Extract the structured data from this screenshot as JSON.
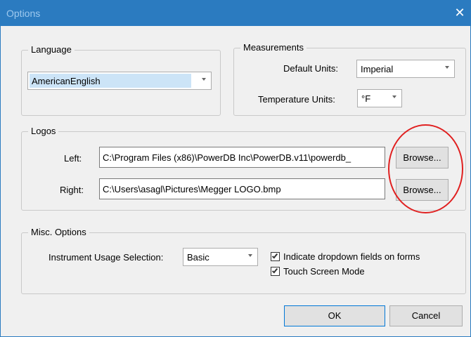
{
  "window": {
    "title": "Options",
    "close_glyph": "✕"
  },
  "language": {
    "group_label": "Language",
    "selected": "AmericanEnglish"
  },
  "measurements": {
    "group_label": "Measurements",
    "default_units_label": "Default Units:",
    "default_units_value": "Imperial",
    "temperature_units_label": "Temperature Units:",
    "temperature_units_value": "°F"
  },
  "logos": {
    "group_label": "Logos",
    "left_label": "Left:",
    "left_path": "C:\\Program Files (x86)\\PowerDB Inc\\PowerDB.v11\\powerdb_",
    "right_label": "Right:",
    "right_path": "C:\\Users\\asagl\\Pictures\\Megger LOGO.bmp",
    "browse_label": "Browse..."
  },
  "misc": {
    "group_label": "Misc. Options",
    "usage_label": "Instrument Usage Selection:",
    "usage_value": "Basic",
    "indicate_dropdown_label": "Indicate dropdown fields on forms",
    "indicate_dropdown_checked": true,
    "touch_screen_label": "Touch Screen Mode",
    "touch_screen_checked": true
  },
  "footer": {
    "ok_label": "OK",
    "cancel_label": "Cancel"
  },
  "colors": {
    "titlebar": "#2b7bc0",
    "annotation": "#e02020",
    "selection": "#cce4f7"
  }
}
